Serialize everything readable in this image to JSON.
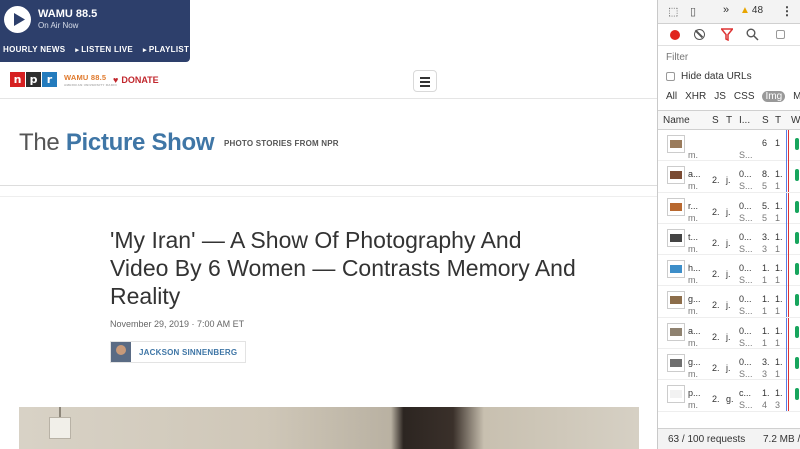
{
  "radio": {
    "station": "WAMU 88.5",
    "status": "On Air Now",
    "links": [
      "HOURLY NEWS",
      "LISTEN LIVE",
      "PLAYLIST"
    ]
  },
  "header": {
    "logo_letters": [
      "n",
      "p",
      "r"
    ],
    "logo_colors": [
      "#d62021",
      "#2d2d2d",
      "#237bbd"
    ],
    "member_station": "WAMU 88.5",
    "member_station_sub": "AMERICAN UNIVERSITY RADIO",
    "donate_label": "DONATE"
  },
  "section": {
    "title_prefix": "The ",
    "title_main": "Picture Show",
    "tagline": "PHOTO STORIES FROM NPR"
  },
  "article": {
    "headline": "'My Iran' — A Show Of Photography And Video By 6 Women — Contrasts Memory And Reality",
    "dateline": "November 29, 2019 · 7:00 AM ET",
    "author": "JACKSON SINNENBERG"
  },
  "devtools": {
    "warning_count": "48",
    "filter_placeholder": "Filter",
    "hide_data_urls": "Hide data URLs",
    "types": [
      "All",
      "XHR",
      "JS",
      "CSS",
      "Img",
      "M"
    ],
    "active_type": "Img",
    "columns": [
      "Name",
      "S",
      "T",
      "I...",
      "S",
      "T",
      "W"
    ],
    "rows": [
      {
        "name": "",
        "name2": "m.",
        "status": "",
        "type": "",
        "init": "",
        "init2": "S...",
        "size": "6",
        "size2": "",
        "time": "1",
        "time2": "",
        "thumb": "#9a7b5c"
      },
      {
        "name": "a...",
        "name2": "m.",
        "status": "2.",
        "type": "j.",
        "init": "0...",
        "init2": "S...",
        "size": "8.",
        "size2": "5",
        "time": "1.",
        "time2": "1",
        "thumb": "#7a4a32"
      },
      {
        "name": "r...",
        "name2": "m.",
        "status": "2.",
        "type": "j.",
        "init": "0...",
        "init2": "S...",
        "size": "5.",
        "size2": "5",
        "time": "1.",
        "time2": "1",
        "thumb": "#b8682f"
      },
      {
        "name": "t...",
        "name2": "m.",
        "status": "2.",
        "type": "j.",
        "init": "0...",
        "init2": "S...",
        "size": "3.",
        "size2": "3",
        "time": "1.",
        "time2": "1",
        "thumb": "#444"
      },
      {
        "name": "h...",
        "name2": "m.",
        "status": "2.",
        "type": "j.",
        "init": "0...",
        "init2": "S...",
        "size": "1.",
        "size2": "1",
        "time": "1.",
        "time2": "1",
        "thumb": "#3d8ec9"
      },
      {
        "name": "g...",
        "name2": "m.",
        "status": "2.",
        "type": "j.",
        "init": "0...",
        "init2": "S...",
        "size": "1.",
        "size2": "1",
        "time": "1.",
        "time2": "1",
        "thumb": "#8c6d4a"
      },
      {
        "name": "a...",
        "name2": "m.",
        "status": "2.",
        "type": "j.",
        "init": "0...",
        "init2": "S...",
        "size": "1.",
        "size2": "1",
        "time": "1.",
        "time2": "1",
        "thumb": "#8f8270"
      },
      {
        "name": "g...",
        "name2": "m.",
        "status": "2.",
        "type": "j.",
        "init": "0...",
        "init2": "S...",
        "size": "3.",
        "size2": "3",
        "time": "1.",
        "time2": "1",
        "thumb": "#6e6e6e"
      },
      {
        "name": "p...",
        "name2": "m.",
        "status": "2.",
        "type": "g.",
        "init": "c...",
        "init2": "S...",
        "size": "1.",
        "size2": "4",
        "time": "1.",
        "time2": "3",
        "thumb": "#f2f2f2"
      }
    ],
    "status_requests": "63 / 100 requests",
    "status_size": "7.2 MB /"
  }
}
